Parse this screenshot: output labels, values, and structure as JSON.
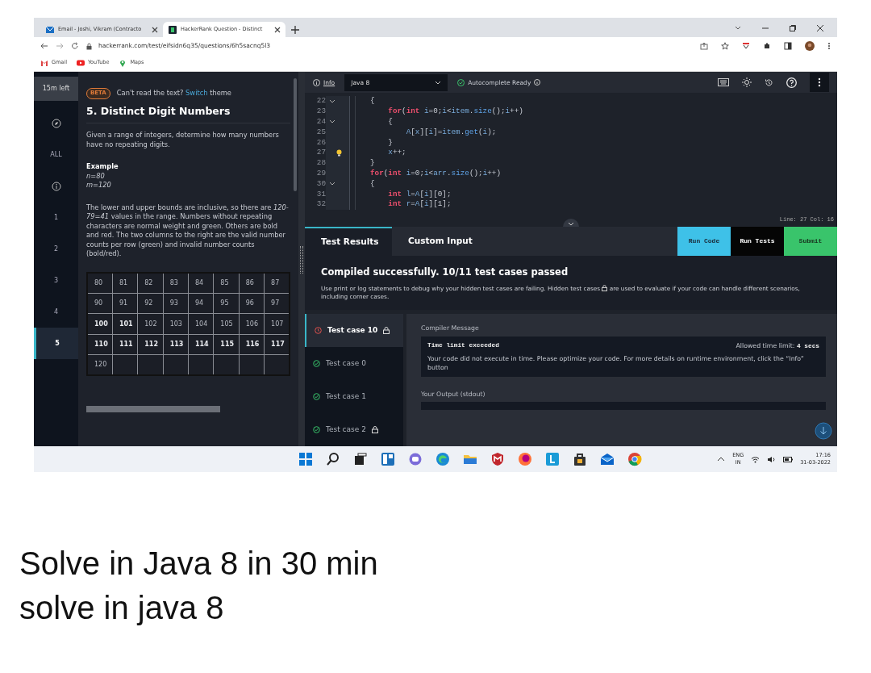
{
  "browser": {
    "tabs": [
      {
        "title": "Email - Joshi, Vikram (Contracto",
        "kind": "mail",
        "selected": false
      },
      {
        "title": "HackerRank Question - Distinct",
        "kind": "site",
        "selected": true
      }
    ],
    "url": "hackerrank.com/test/eifsidn6q35/questions/6h5sacnq5l3",
    "bookmarks": [
      {
        "label": "Gmail",
        "kind": "gmail"
      },
      {
        "label": "YouTube",
        "kind": "youtube"
      },
      {
        "label": "Maps",
        "kind": "maps"
      }
    ]
  },
  "rail": {
    "timer": "15m left",
    "items": [
      {
        "kind": "compass",
        "selected": false
      },
      {
        "kind": "label",
        "label": "ALL",
        "selected": false
      },
      {
        "kind": "info",
        "selected": false
      },
      {
        "kind": "label",
        "label": "1",
        "selected": false
      },
      {
        "kind": "label",
        "label": "2",
        "selected": false
      },
      {
        "kind": "label",
        "label": "3",
        "selected": false
      },
      {
        "kind": "label",
        "label": "4",
        "selected": false
      },
      {
        "kind": "label",
        "label": "5",
        "selected": true
      }
    ]
  },
  "problem": {
    "beta": "BETA",
    "notice": "Can't read the text? ",
    "switch_link": "Switch",
    "notice_end": " theme",
    "title": "5. Distinct Digit Numbers",
    "intro": "Given a range of integers, determine how many numbers have no repeating digits.",
    "example_heading": "Example",
    "example_lines": [
      "n=80",
      "m=120"
    ],
    "explanation": "The lower and upper bounds are inclusive, so there are *120-79=41* values in the range. Numbers without repeating characters are normal weight and green. Others are bold and red. The two columns to the right are the valid number counts per row (green) and invalid number counts (bold/red).",
    "table": {
      "rows": [
        [
          {
            "text": "80",
            "bold": false
          },
          {
            "text": "81",
            "bold": false
          },
          {
            "text": "82",
            "bold": false
          },
          {
            "text": "83",
            "bold": false
          },
          {
            "text": "84",
            "bold": false
          },
          {
            "text": "85",
            "bold": false
          },
          {
            "text": "86",
            "bold": false
          },
          {
            "text": "87",
            "bold": false
          }
        ],
        [
          {
            "text": "90",
            "bold": false
          },
          {
            "text": "91",
            "bold": false
          },
          {
            "text": "92",
            "bold": false
          },
          {
            "text": "93",
            "bold": false
          },
          {
            "text": "94",
            "bold": false
          },
          {
            "text": "95",
            "bold": false
          },
          {
            "text": "96",
            "bold": false
          },
          {
            "text": "97",
            "bold": false
          }
        ],
        [
          {
            "text": "100",
            "bold": true
          },
          {
            "text": "101",
            "bold": true
          },
          {
            "text": "102",
            "bold": false
          },
          {
            "text": "103",
            "bold": false
          },
          {
            "text": "104",
            "bold": false
          },
          {
            "text": "105",
            "bold": false
          },
          {
            "text": "106",
            "bold": false
          },
          {
            "text": "107",
            "bold": false
          }
        ],
        [
          {
            "text": "110",
            "bold": true
          },
          {
            "text": "111",
            "bold": true
          },
          {
            "text": "112",
            "bold": true
          },
          {
            "text": "113",
            "bold": true
          },
          {
            "text": "114",
            "bold": true
          },
          {
            "text": "115",
            "bold": true
          },
          {
            "text": "116",
            "bold": true
          },
          {
            "text": "117",
            "bold": true
          }
        ],
        [
          {
            "text": "120",
            "bold": false
          }
        ]
      ]
    }
  },
  "editor": {
    "info_link": "Info",
    "language": "Java 8",
    "autocomplete": "Autocomplete Ready",
    "cursor": "Line: 27 Col: 16",
    "lines": [
      {
        "number": "22",
        "foldable": true,
        "lightbulb": false,
        "tokens": [
          {
            "text": "{",
            "kind": "punct"
          }
        ]
      },
      {
        "number": "23",
        "foldable": false,
        "lightbulb": false,
        "tokens": [
          {
            "text": "    for",
            "kind": "keyword"
          },
          {
            "text": "(",
            "kind": "punct"
          },
          {
            "text": "int",
            "kind": "keyword"
          },
          {
            "text": " i",
            "kind": "name"
          },
          {
            "text": "=0;",
            "kind": "punct"
          },
          {
            "text": "i",
            "kind": "name"
          },
          {
            "text": "<",
            "kind": "punct"
          },
          {
            "text": "item",
            "kind": "name"
          },
          {
            "text": ".",
            "kind": "punct"
          },
          {
            "text": "size",
            "kind": "call"
          },
          {
            "text": "();",
            "kind": "punct"
          },
          {
            "text": "i",
            "kind": "name"
          },
          {
            "text": "++)",
            "kind": "punct"
          }
        ]
      },
      {
        "number": "24",
        "foldable": true,
        "lightbulb": false,
        "tokens": [
          {
            "text": "    {",
            "kind": "punct"
          }
        ]
      },
      {
        "number": "25",
        "foldable": false,
        "lightbulb": false,
        "tokens": [
          {
            "text": "        A",
            "kind": "name"
          },
          {
            "text": "[",
            "kind": "punct"
          },
          {
            "text": "x",
            "kind": "name"
          },
          {
            "text": "][",
            "kind": "punct"
          },
          {
            "text": "i",
            "kind": "name"
          },
          {
            "text": "]=",
            "kind": "punct"
          },
          {
            "text": "item",
            "kind": "name"
          },
          {
            "text": ".",
            "kind": "punct"
          },
          {
            "text": "get",
            "kind": "call"
          },
          {
            "text": "(",
            "kind": "punct"
          },
          {
            "text": "i",
            "kind": "name"
          },
          {
            "text": ");",
            "kind": "punct"
          }
        ]
      },
      {
        "number": "26",
        "foldable": false,
        "lightbulb": false,
        "tokens": [
          {
            "text": "    }",
            "kind": "punct"
          }
        ]
      },
      {
        "number": "27",
        "foldable": false,
        "lightbulb": true,
        "tokens": [
          {
            "text": "    x",
            "kind": "name"
          },
          {
            "text": "++;",
            "kind": "punct"
          }
        ]
      },
      {
        "number": "28",
        "foldable": false,
        "lightbulb": false,
        "tokens": [
          {
            "text": "}",
            "kind": "punct"
          }
        ]
      },
      {
        "number": "29",
        "foldable": false,
        "lightbulb": false,
        "tokens": [
          {
            "text": "for",
            "kind": "keyword"
          },
          {
            "text": "(",
            "kind": "punct"
          },
          {
            "text": "int",
            "kind": "keyword"
          },
          {
            "text": " i",
            "kind": "name"
          },
          {
            "text": "=0;",
            "kind": "punct"
          },
          {
            "text": "i",
            "kind": "name"
          },
          {
            "text": "<",
            "kind": "punct"
          },
          {
            "text": "arr",
            "kind": "name"
          },
          {
            "text": ".",
            "kind": "punct"
          },
          {
            "text": "size",
            "kind": "call"
          },
          {
            "text": "();",
            "kind": "punct"
          },
          {
            "text": "i",
            "kind": "name"
          },
          {
            "text": "++)",
            "kind": "punct"
          }
        ]
      },
      {
        "number": "30",
        "foldable": true,
        "lightbulb": false,
        "tokens": [
          {
            "text": "{",
            "kind": "punct"
          }
        ]
      },
      {
        "number": "31",
        "foldable": false,
        "lightbulb": false,
        "tokens": [
          {
            "text": "    int",
            "kind": "keyword"
          },
          {
            "text": " l",
            "kind": "name"
          },
          {
            "text": "=",
            "kind": "punct"
          },
          {
            "text": "A",
            "kind": "name"
          },
          {
            "text": "[",
            "kind": "punct"
          },
          {
            "text": "i",
            "kind": "name"
          },
          {
            "text": "][0];",
            "kind": "punct"
          }
        ]
      },
      {
        "number": "32",
        "foldable": false,
        "lightbulb": false,
        "tokens": [
          {
            "text": "    int",
            "kind": "keyword"
          },
          {
            "text": " r",
            "kind": "name"
          },
          {
            "text": "=",
            "kind": "punct"
          },
          {
            "text": "A",
            "kind": "name"
          },
          {
            "text": "[",
            "kind": "punct"
          },
          {
            "text": "i",
            "kind": "name"
          },
          {
            "text": "][1];",
            "kind": "punct"
          }
        ]
      }
    ]
  },
  "results": {
    "tabs": [
      {
        "label": "Test Results",
        "selected": true
      },
      {
        "label": "Custom Input",
        "selected": false
      }
    ],
    "buttons": [
      {
        "label": "Run Code",
        "kind": "run"
      },
      {
        "label": "Run Tests",
        "kind": "tests"
      },
      {
        "label": "Submit",
        "kind": "submit"
      }
    ],
    "summary": "Compiled successfully. 10/11 test cases passed",
    "info_before": "Use print or log statements to debug why your hidden test cases are failing. Hidden test cases ",
    "info_after": " are used to evaluate if your code can handle different scenarios, including corner cases.",
    "cases": [
      {
        "label": "Test case 10",
        "passed": false,
        "locked": true,
        "selected": true
      },
      {
        "label": "Test case 0",
        "passed": true,
        "locked": false,
        "selected": false
      },
      {
        "label": "Test case 1",
        "passed": true,
        "locked": false,
        "selected": false
      },
      {
        "label": "Test case 2",
        "passed": true,
        "locked": true,
        "selected": false
      }
    ],
    "compiler_heading": "Compiler Message",
    "error_title": "Time limit exceeded",
    "limit_label": "Allowed time limit: ",
    "limit_value": "4 secs",
    "message": "Your code did not execute in time. Please optimize your code. For more details on runtime environment, click the “Info” button",
    "output_heading": "Your Output (stdout)"
  },
  "taskbar": {
    "language": "ENG",
    "region": "IN",
    "time": "17:16",
    "date": "31-03-2022"
  },
  "caption": [
    "Solve in Java 8 in 30 min",
    "solve in java 8"
  ]
}
